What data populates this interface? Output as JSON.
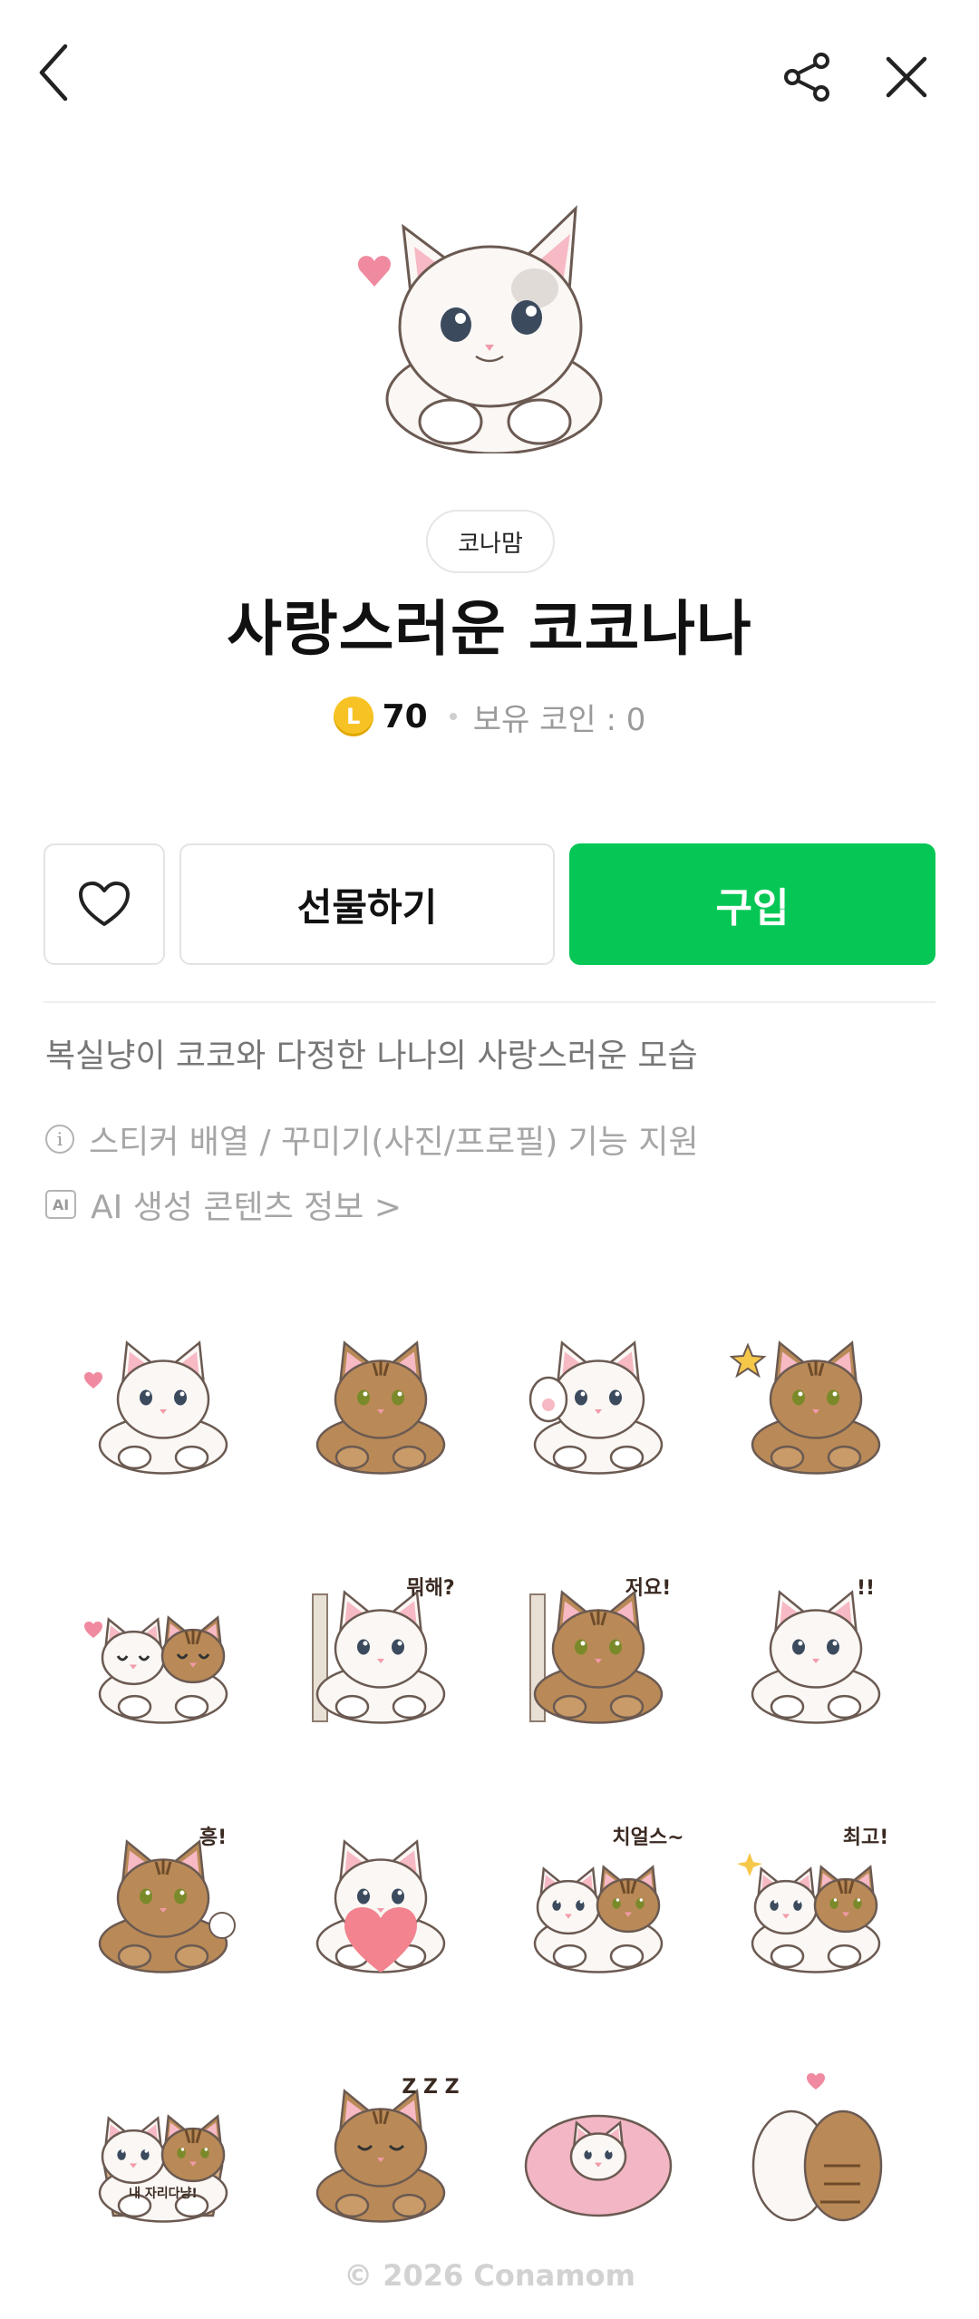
{
  "header": {
    "back_icon": "chevron-left-icon",
    "share_icon": "share-icon",
    "close_icon": "close-icon"
  },
  "product": {
    "author": "코나맘",
    "title": "사랑스러운 코코나나",
    "coin_symbol": "L",
    "price": "70",
    "owned_coins": "보유 코인 : 0",
    "description": "복실냥이 코코와 다정한 나나의 사랑스러운 모습"
  },
  "actions": {
    "like_icon": "heart-outline-icon",
    "gift_label": "선물하기",
    "buy_label": "구입"
  },
  "info": {
    "feature_text": "스티커 배열 / 꾸미기(사진/프로필) 기능 지원",
    "ai_badge": "AI",
    "ai_text": "AI 생성 콘텐츠 정보 >"
  },
  "stickers": [
    {
      "cat": "white",
      "deco": "heart",
      "text": ""
    },
    {
      "cat": "tabby",
      "deco": "none",
      "text": ""
    },
    {
      "cat": "white",
      "deco": "paw",
      "text": ""
    },
    {
      "cat": "tabby",
      "deco": "star",
      "text": ""
    },
    {
      "cat": "pair",
      "deco": "heart",
      "text": ""
    },
    {
      "cat": "white",
      "deco": "wall",
      "text": "뭐해?"
    },
    {
      "cat": "tabby",
      "deco": "wall",
      "text": "저요!"
    },
    {
      "cat": "white",
      "deco": "exclaim",
      "text": "!!"
    },
    {
      "cat": "tabby",
      "deco": "puff",
      "text": "흥!"
    },
    {
      "cat": "white",
      "deco": "bigheart",
      "text": ""
    },
    {
      "cat": "pair",
      "deco": "cups",
      "text": "치얼스~"
    },
    {
      "cat": "pair",
      "deco": "sparkle",
      "text": "최고!"
    },
    {
      "cat": "pair",
      "deco": "box",
      "text": "내 자리다냥!"
    },
    {
      "cat": "tabby",
      "deco": "sleep",
      "text": "Z Z Z"
    },
    {
      "cat": "white",
      "deco": "blanket",
      "text": ""
    },
    {
      "cat": "pair",
      "deco": "back",
      "text": ""
    }
  ],
  "footer": {
    "copyright": "© 2026 Conamom"
  },
  "colors": {
    "buy_green": "#06c755",
    "coin_yellow": "#f7c324",
    "tabby": "#b98a57",
    "white_cat": "#faf7f4",
    "heart_pink": "#f08aa0"
  }
}
